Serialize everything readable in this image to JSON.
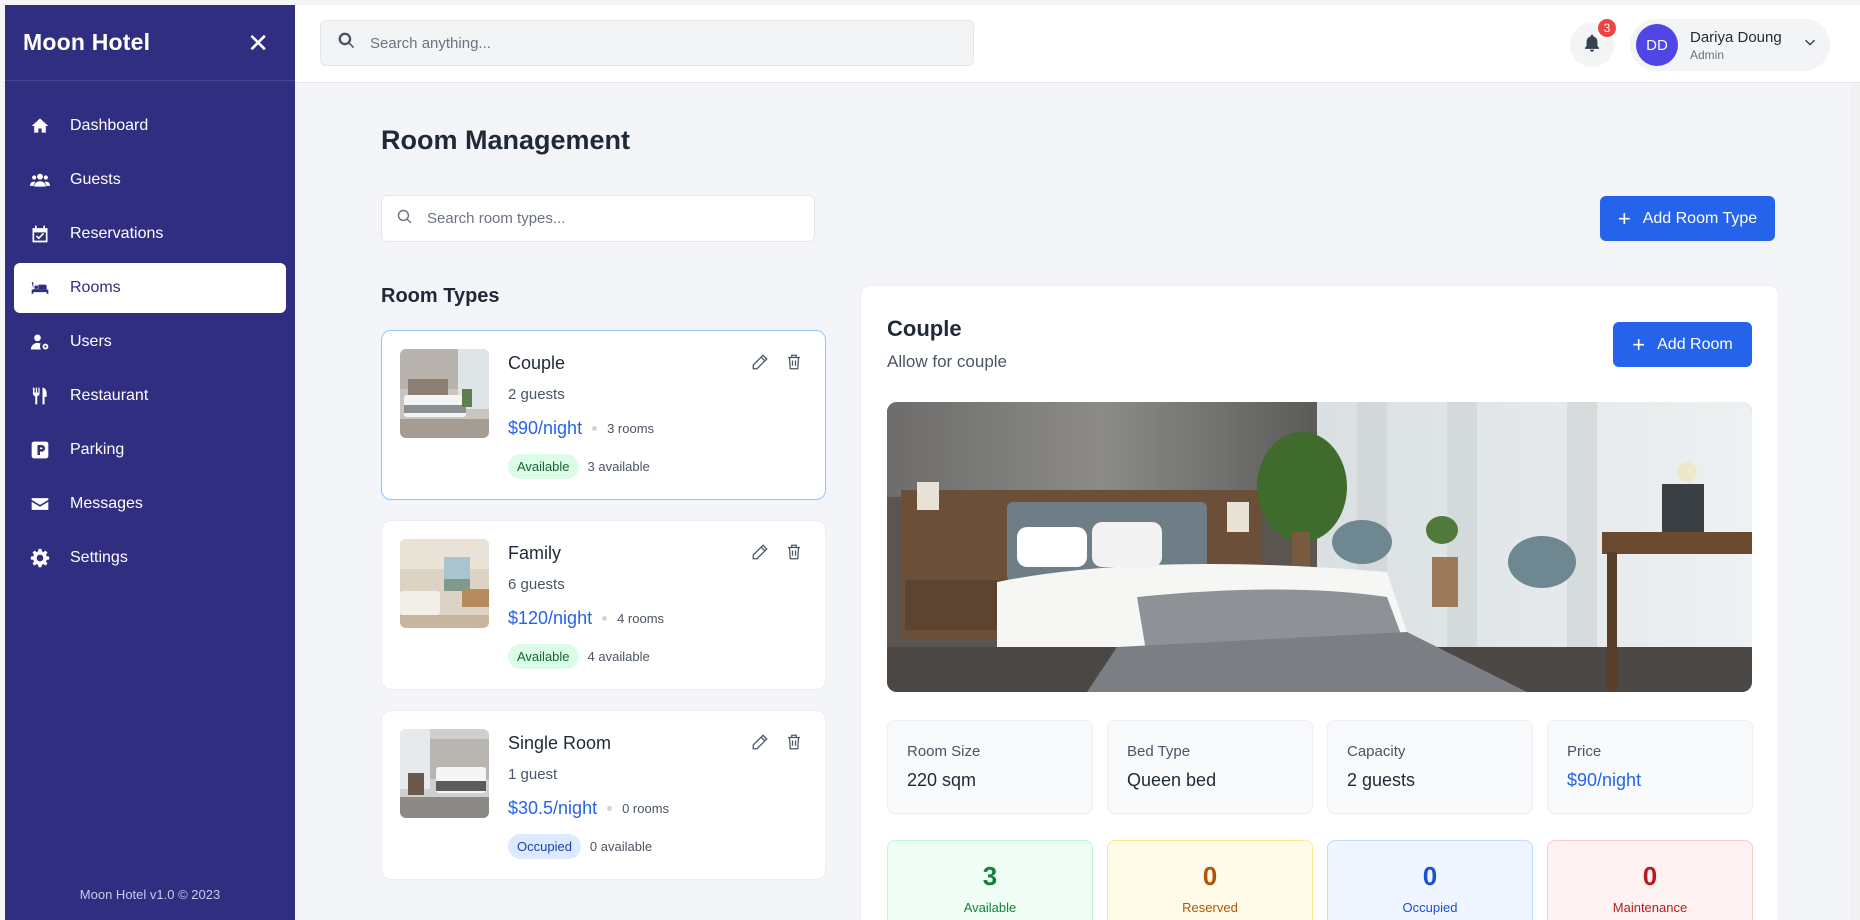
{
  "app": {
    "brand": "Moon Hotel",
    "footer": "Moon Hotel v1.0 © 2023"
  },
  "sidebar": {
    "items": [
      {
        "label": "Dashboard",
        "icon": "home-icon"
      },
      {
        "label": "Guests",
        "icon": "users-icon"
      },
      {
        "label": "Reservations",
        "icon": "calendar-check-icon"
      },
      {
        "label": "Rooms",
        "icon": "bed-icon",
        "active": true
      },
      {
        "label": "Users",
        "icon": "user-cog-icon"
      },
      {
        "label": "Restaurant",
        "icon": "utensils-icon"
      },
      {
        "label": "Parking",
        "icon": "parking-icon"
      },
      {
        "label": "Messages",
        "icon": "envelope-icon"
      },
      {
        "label": "Settings",
        "icon": "gear-icon"
      }
    ]
  },
  "header": {
    "search_placeholder": "Search anything...",
    "notifications_count": "3",
    "user": {
      "initials": "DD",
      "name": "Dariya Doung",
      "role": "Admin"
    }
  },
  "main": {
    "title": "Room Management",
    "search_placeholder": "Search room types...",
    "add_room_type_label": "Add Room Type",
    "section_title": "Room Types",
    "room_types": [
      {
        "name": "Couple",
        "guests": "2 guests",
        "price": "$90/night",
        "rooms": "3 rooms",
        "status": "Available",
        "available": "3 available"
      },
      {
        "name": "Family",
        "guests": "6 guests",
        "price": "$120/night",
        "rooms": "4 rooms",
        "status": "Available",
        "available": "4 available"
      },
      {
        "name": "Single Room",
        "guests": "1 guest",
        "price": "$30.5/night",
        "rooms": "0 rooms",
        "status": "Occupied",
        "available": "0 available"
      }
    ]
  },
  "detail": {
    "title": "Couple",
    "subtitle": "Allow for couple",
    "add_room_label": "Add Room",
    "stats": [
      {
        "label": "Room Size",
        "value": "220 sqm"
      },
      {
        "label": "Bed Type",
        "value": "Queen bed"
      },
      {
        "label": "Capacity",
        "value": "2 guests"
      },
      {
        "label": "Price",
        "value": "$90/night"
      }
    ],
    "statuses": [
      {
        "count": "3",
        "label": "Available"
      },
      {
        "count": "0",
        "label": "Reserved"
      },
      {
        "count": "0",
        "label": "Occupied"
      },
      {
        "count": "0",
        "label": "Maintenance"
      }
    ]
  },
  "colors": {
    "sidebar": "#302e81",
    "accent": "#2563eb",
    "available": "#15803d",
    "reserved": "#b45309",
    "occupied": "#1d4ed8",
    "maintenance": "#b91c1c"
  }
}
